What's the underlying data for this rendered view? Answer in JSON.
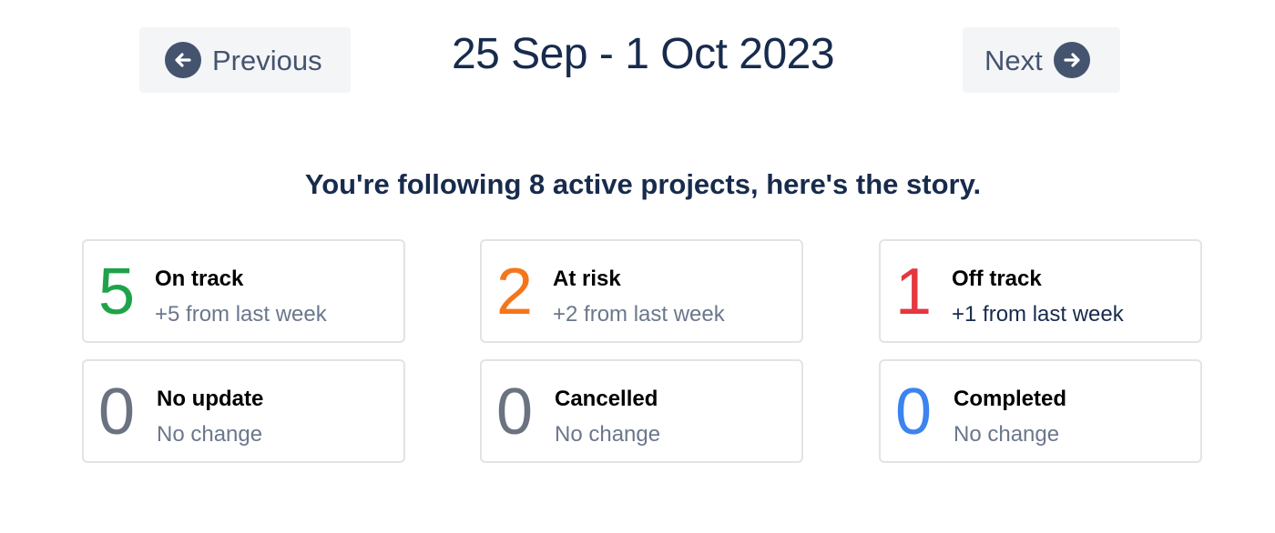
{
  "navigation": {
    "previous_label": "Previous",
    "next_label": "Next",
    "date_range": "25 Sep - 1 Oct 2023"
  },
  "summary": "You're following 8 active projects, here's the story.",
  "cards": [
    {
      "count": "5",
      "title": "On track",
      "change": "+5 from last week",
      "count_color": "#1fa34a",
      "change_color": "#6b778c"
    },
    {
      "count": "2",
      "title": "At risk",
      "change": "+2 from last week",
      "count_color": "#f5761a",
      "change_color": "#6b778c"
    },
    {
      "count": "1",
      "title": "Off track",
      "change": "+1 from last week",
      "count_color": "#e5373f",
      "change_color": "#172b4d"
    },
    {
      "count": "0",
      "title": "No update",
      "change": "No change",
      "count_color": "#6b7280",
      "change_color": "#6b778c"
    },
    {
      "count": "0",
      "title": "Cancelled",
      "change": "No change",
      "count_color": "#6b7280",
      "change_color": "#6b778c"
    },
    {
      "count": "0",
      "title": "Completed",
      "change": "No change",
      "count_color": "#3d83f0",
      "change_color": "#6b778c"
    }
  ],
  "icons": {
    "previous": "arrow-left-circle-icon",
    "next": "arrow-right-circle-icon"
  }
}
